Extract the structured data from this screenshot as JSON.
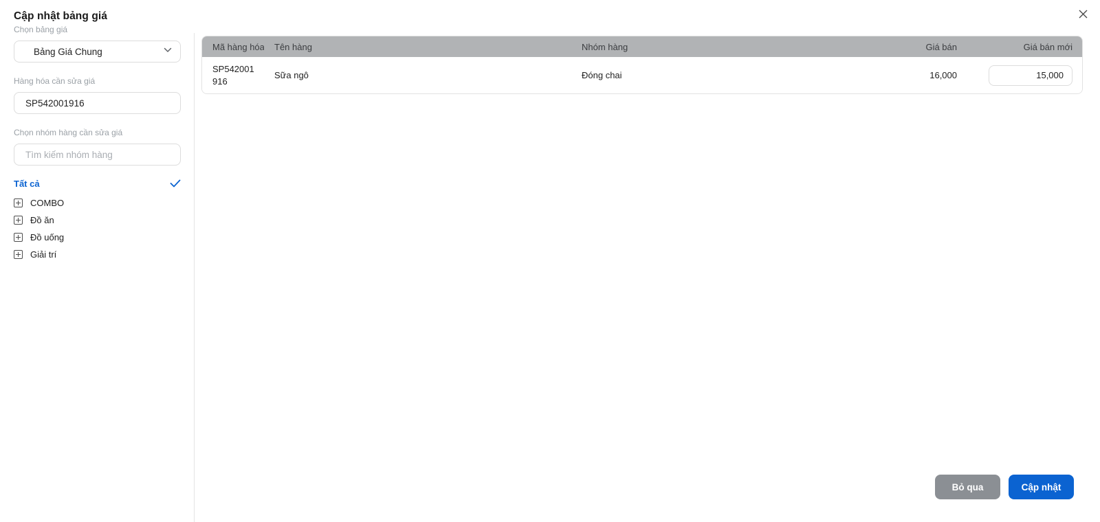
{
  "dialog": {
    "title": "Cập nhật bảng giá"
  },
  "sidebar": {
    "price_list": {
      "label": "Chọn bảng giá",
      "value": "Bảng Giá Chung"
    },
    "product_code": {
      "label": "Hàng hóa cần sửa giá",
      "value": "SP542001916"
    },
    "group_filter": {
      "label": "Chọn nhóm hàng cần sửa giá",
      "placeholder": "Tìm kiếm nhóm hàng"
    },
    "all_label": "Tất cả",
    "groups": [
      {
        "label": "COMBO"
      },
      {
        "label": "Đồ ăn"
      },
      {
        "label": "Đồ uống"
      },
      {
        "label": "Giải trí"
      }
    ]
  },
  "table": {
    "headers": [
      "Mã hàng hóa",
      "Tên hàng",
      "Nhóm hàng",
      "Giá bán",
      "Giá bán mới"
    ],
    "rows": [
      {
        "code": "SP542001916",
        "name": "Sữa ngô",
        "group": "Đóng chai",
        "price": "16,000",
        "new_price": "15,000"
      }
    ]
  },
  "footer": {
    "cancel_label": "Bỏ qua",
    "submit_label": "Cập nhật"
  },
  "icons": {
    "close": "close-icon",
    "chevron_down": "chevron-down-icon",
    "check": "check-icon",
    "expand_plus": "plus-square-icon"
  },
  "colors": {
    "accent_blue": "#0b63d1",
    "cancel_gray": "#8b8f94",
    "table_header_bg": "#b1b3b5",
    "border": "#dcdcdc",
    "label_gray": "#9aa0a6"
  }
}
